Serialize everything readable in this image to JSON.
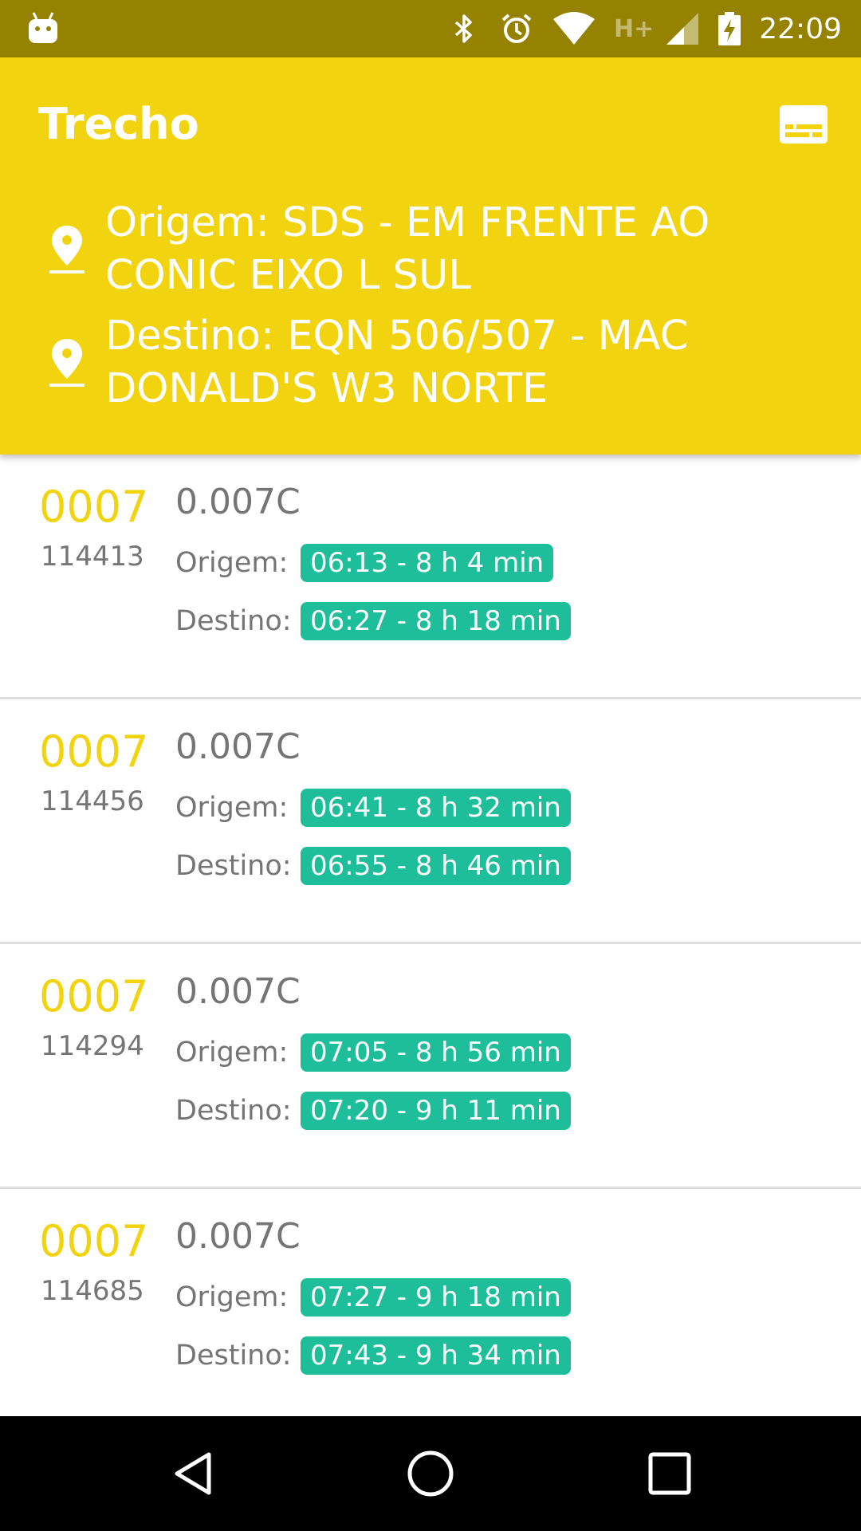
{
  "status_bar": {
    "time": "22:09",
    "network_label": "H+",
    "icons": [
      "android-notification-icon",
      "bluetooth-icon",
      "alarm-icon",
      "wifi-icon",
      "cell-signal-icon",
      "battery-charging-icon"
    ]
  },
  "app_bar": {
    "title": "Trecho",
    "action_icon": "subtitles-icon",
    "origin": "Origem: SDS - EM FRENTE AO CONIC EIXO L SUL",
    "destination": "Destino: EQN 506/507 - MAC DONALD'S W3 NORTE"
  },
  "trips": [
    {
      "line": "0007",
      "trip_id": "114413",
      "vehicle": "0.007C",
      "origin_label": "Origem:",
      "origin_time": "06:13 - 8 h 4 min",
      "dest_label": "Destino:",
      "dest_time": "06:27 - 8 h 18 min"
    },
    {
      "line": "0007",
      "trip_id": "114456",
      "vehicle": "0.007C",
      "origin_label": "Origem:",
      "origin_time": "06:41 - 8 h 32 min",
      "dest_label": "Destino:",
      "dest_time": "06:55 - 8 h 46 min"
    },
    {
      "line": "0007",
      "trip_id": "114294",
      "vehicle": "0.007C",
      "origin_label": "Origem:",
      "origin_time": "07:05 - 8 h 56 min",
      "dest_label": "Destino:",
      "dest_time": "07:20 - 9 h 11 min"
    },
    {
      "line": "0007",
      "trip_id": "114685",
      "vehicle": "0.007C",
      "origin_label": "Origem:",
      "origin_time": "07:27 - 9 h 18 min",
      "dest_label": "Destino:",
      "dest_time": "07:43 - 9 h 34 min"
    }
  ],
  "nav_bar": {
    "icons": [
      "back-icon",
      "home-icon",
      "recents-icon"
    ]
  },
  "colors": {
    "app_bar": "#f2d30f",
    "status_bar": "#948200",
    "line_number": "#f2d30f",
    "badge": "#1fbe9a",
    "secondary_text": "#757575"
  }
}
